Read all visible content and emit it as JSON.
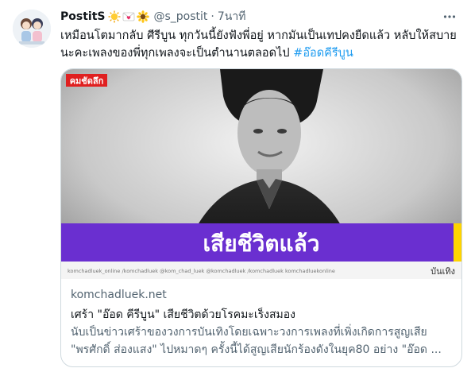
{
  "tweet": {
    "display_name": "PostitS",
    "handle": "@s_postit",
    "separator": "·",
    "time": "7นาที",
    "text_line1": "เหมือนโตมากลับ ศีรีบูน ทุกวันนี้ยังฟังพี่อยู่ หากมันเป็นเทปคงยืดแล้ว หลับให้สบาย",
    "text_line2": "นะคะเพลงของพี่ทุกเพลงจะเป็นตำนานตลอดไป ",
    "hashtag": "#อ๊อดคีรีบูน"
  },
  "card": {
    "media": {
      "logo_text": "คมชัดลึก",
      "headline": "เสียชีวิตแล้ว",
      "category": "บันเทิง",
      "social_strip": "komchadluek_online  /komchadluek  @kom_chad_luek  @komchadluek  /komchadluek  komchadluekonline"
    },
    "domain": "komchadluek.net",
    "title": "เศร้า \"อ๊อด คีรีบูน\" เสียชีวิตด้วยโรคมะเร็งสมอง",
    "desc_line1": "นับเป็นข่าวเศร้าของวงการบันเทิงโดยเฉพาะวงการเพลงที่เพิ่งเกิดการสูญเสีย",
    "desc_line2": "\"พรศักดิ์ ส่องแสง\" ไปหมาดๆ ครั้งนี้ได้สูญเสียนักร้องดังในยุค80 อย่าง \"อ๊อด ..."
  },
  "icons": {
    "more": "more-horizontal-icon",
    "emoji1": "sun-icon",
    "emoji2": "heart-letter-icon",
    "emoji3": "sunflower-icon"
  },
  "colors": {
    "accent": "#1d9bf0",
    "purple_banner": "#6a2fd0",
    "yellow_bar": "#ffd400",
    "logo_red": "#e02020"
  }
}
